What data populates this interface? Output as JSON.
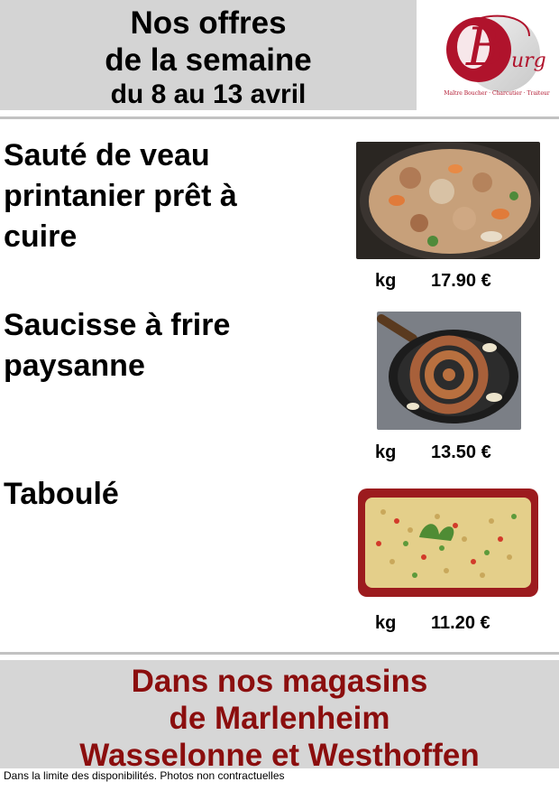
{
  "header": {
    "title_line1": "Nos offres",
    "title_line2": "de la semaine",
    "title_line3": "du 8 au 13 avril"
  },
  "logo": {
    "brand_letter": "Burg",
    "tagline": "Maître Boucher · Charcutier · Traiteur",
    "colors": {
      "primary": "#b0132c",
      "secondary": "#8a8a8a"
    }
  },
  "products": [
    {
      "name_lines": [
        "Sauté de veau",
        "printanier prêt à",
        "cuire"
      ],
      "unit": "kg",
      "price": "17.90 €",
      "photo_icon": "veal-stew-photo"
    },
    {
      "name_lines": [
        "Saucisse à frire",
        "paysanne"
      ],
      "unit": "kg",
      "price": "13.50 €",
      "photo_icon": "sausage-pan-photo"
    },
    {
      "name_lines": [
        "Taboulé"
      ],
      "unit": "kg",
      "price": "11.20 €",
      "photo_icon": "tabbouleh-dish-photo"
    }
  ],
  "footer": {
    "line1": "Dans nos magasins",
    "line2": "de Marlenheim",
    "line3": "Wasselonne et Westhoffen",
    "color": "#8b0e0e"
  },
  "disclaimer": "Dans la limite des disponibilités. Photos non contractuelles"
}
